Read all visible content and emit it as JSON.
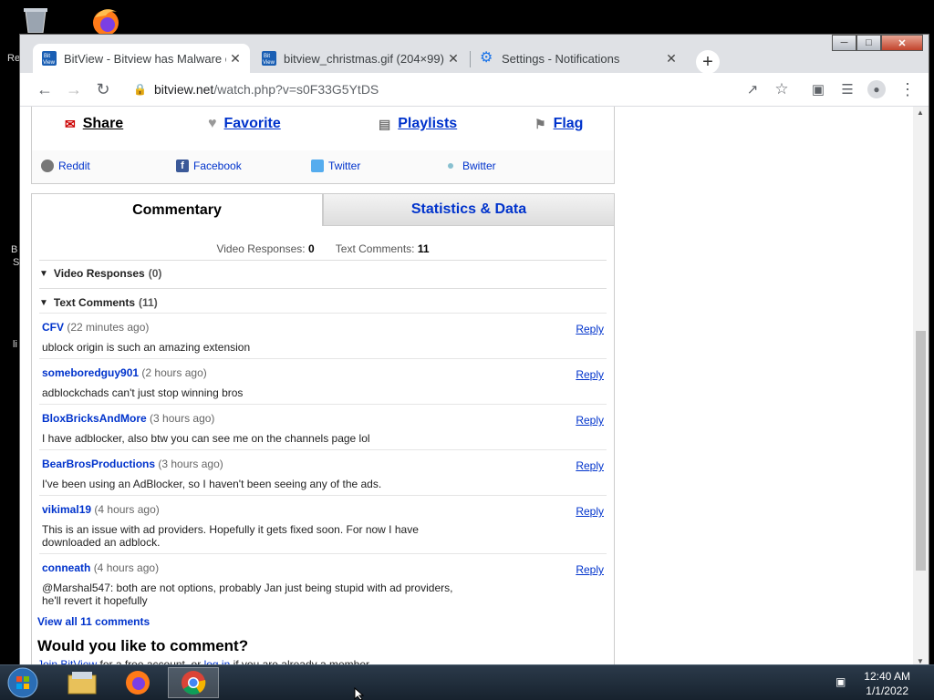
{
  "desktop": {
    "fragments": [
      "Re",
      "B",
      "S",
      "li"
    ]
  },
  "browser": {
    "tabs": [
      {
        "title": "BitView - Bitview has Malware or",
        "icon": "bitview-favicon",
        "active": true
      },
      {
        "title": "bitview_christmas.gif (204×99)",
        "icon": "bitview-favicon",
        "active": false
      },
      {
        "title": "Settings - Notifications",
        "icon": "gear-icon",
        "active": false
      }
    ],
    "url_host": "bitview.net",
    "url_path": "/watch.php?v=s0F33G5YtDS"
  },
  "share_bar": {
    "items": [
      {
        "label": "Share",
        "icon": "share-icon"
      },
      {
        "label": "Favorite",
        "icon": "heart-icon"
      },
      {
        "label": "Playlists",
        "icon": "playlist-icon"
      },
      {
        "label": "Flag",
        "icon": "flag-icon"
      }
    ],
    "social": [
      {
        "label": "Reddit",
        "icon": "reddit-icon",
        "color": "#777777"
      },
      {
        "label": "Facebook",
        "icon": "facebook-icon",
        "color": "#3b5998"
      },
      {
        "label": "Twitter",
        "icon": "twitter-icon",
        "color": "#55acee"
      },
      {
        "label": "Bwitter",
        "icon": "bwitter-icon",
        "color": "#88c0d0"
      }
    ]
  },
  "tabs": {
    "commentary": "Commentary",
    "stats": "Statistics & Data"
  },
  "counts": {
    "video_responses_label": "Video Responses:",
    "video_responses": "0",
    "text_comments_label": "Text Comments:",
    "text_comments": "11"
  },
  "sections": {
    "video_responses": "Video Responses",
    "video_responses_count": "(0)",
    "text_comments": "Text Comments",
    "text_comments_count": "(11)"
  },
  "comments": [
    {
      "user": "CFV",
      "time": "(22 minutes ago)",
      "text": "ublock origin is such an amazing extension",
      "reply": "Reply"
    },
    {
      "user": "someboredguy901",
      "time": "(2 hours ago)",
      "text": "adblockchads can't just stop winning bros",
      "reply": "Reply"
    },
    {
      "user": "BloxBricksAndMore",
      "time": "(3 hours ago)",
      "text": "I have adblocker, also btw you can see me on the channels page lol",
      "reply": "Reply"
    },
    {
      "user": "BearBrosProductions",
      "time": "(3 hours ago)",
      "text": "I've been using an AdBlocker, so I haven't been seeing any of the ads.",
      "reply": "Reply"
    },
    {
      "user": "vikimal19",
      "time": "(4 hours ago)",
      "text": "This is an issue with ad providers. Hopefully it gets fixed soon. For now I have downloaded an adblock.",
      "reply": "Reply"
    },
    {
      "user": "conneath",
      "time": "(4 hours ago)",
      "text": "@Marshal547: both are not options, probably Jan just being stupid with ad providers, he'll revert it hopefully",
      "reply": "Reply"
    }
  ],
  "view_all": "View all 11 comments",
  "would_comment": "Would you like to comment?",
  "join": {
    "link1": "Join BitView",
    "mid": " for a free account, or ",
    "link2": "log in",
    "end": " if you are already a member."
  },
  "taskbar": {
    "time": "12:40 AM",
    "date": "1/1/2022",
    "apps": [
      "file-explorer-icon",
      "firefox-icon",
      "chrome-icon"
    ]
  }
}
